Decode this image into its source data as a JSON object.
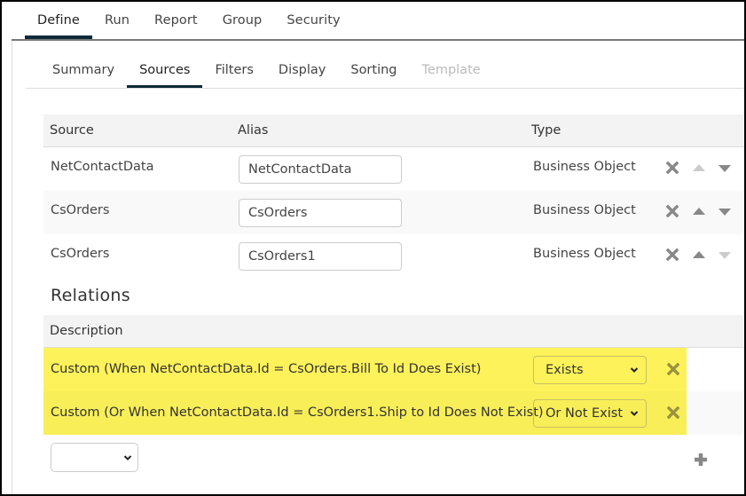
{
  "top_tabs": [
    {
      "label": "Define",
      "active": true
    },
    {
      "label": "Run",
      "active": false
    },
    {
      "label": "Report",
      "active": false
    },
    {
      "label": "Group",
      "active": false
    },
    {
      "label": "Security",
      "active": false
    }
  ],
  "sub_tabs": [
    {
      "label": "Summary",
      "active": false
    },
    {
      "label": "Sources",
      "active": true
    },
    {
      "label": "Filters",
      "active": false
    },
    {
      "label": "Display",
      "active": false
    },
    {
      "label": "Sorting",
      "active": false
    },
    {
      "label": "Template",
      "disabled": true
    }
  ],
  "sources": {
    "headers": {
      "source": "Source",
      "alias": "Alias",
      "type": "Type"
    },
    "rows": [
      {
        "source": "NetContactData",
        "alias": "NetContactData",
        "type": "Business Object",
        "up_enabled": false,
        "down_enabled": true
      },
      {
        "source": "CsOrders",
        "alias": "CsOrders",
        "type": "Business Object",
        "up_enabled": true,
        "down_enabled": true
      },
      {
        "source": "CsOrders",
        "alias": "CsOrders1",
        "type": "Business Object",
        "up_enabled": true,
        "down_enabled": false
      }
    ]
  },
  "relations": {
    "title": "Relations",
    "header": "Description",
    "highlight_color": "#fdf25a",
    "rows": [
      {
        "description": "Custom (When NetContactData.Id = CsOrders.Bill To Id Does Exist)",
        "type": "Exists"
      },
      {
        "description": "Custom (Or When NetContactData.Id = CsOrders1.Ship to Id Does Not Exist)",
        "type": "Or Not Exist"
      }
    ],
    "new_relation_select": ""
  },
  "icons": {
    "remove": "close-x-icon",
    "move_up": "triangle-up-icon",
    "move_down": "triangle-down-icon",
    "add": "plus-icon",
    "dropdown": "chevron-down-icon"
  },
  "colors": {
    "active_tab_underline": "#0e2a38",
    "header_bg": "#f3f3f3",
    "icon_gray": "#888888"
  }
}
